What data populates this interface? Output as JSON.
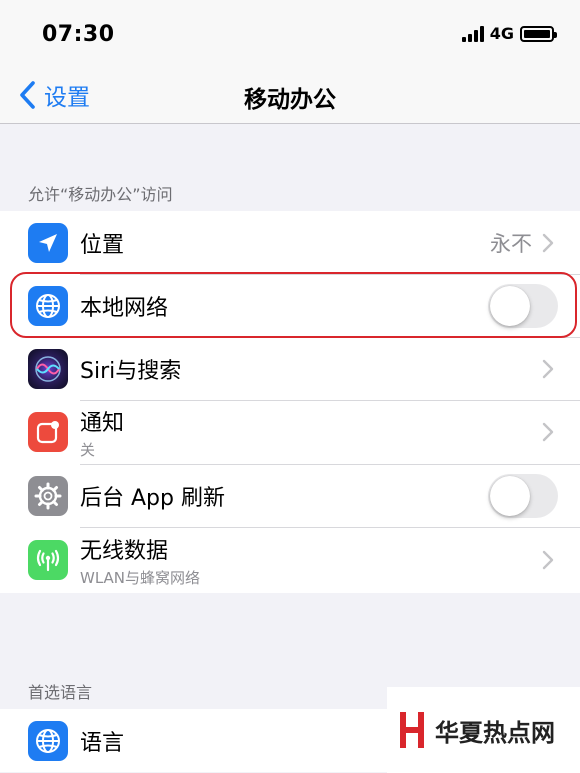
{
  "status_bar": {
    "time": "07:30",
    "network": "4G",
    "icons": [
      "signal-bars-icon",
      "battery-icon"
    ]
  },
  "nav": {
    "back_label": "设置",
    "title": "移动办公"
  },
  "section_allow": {
    "header": "允许“移动办公”访问",
    "rows": [
      {
        "label": "位置",
        "value": "永不",
        "icon": "location-arrow-icon",
        "icon_color": "#1e7cf2"
      },
      {
        "label": "本地网络",
        "icon": "globe-icon",
        "icon_color": "#1e7cf2",
        "toggle_on": false
      },
      {
        "label": "Siri与搜索",
        "icon": "siri-icon",
        "icon_color": "#2b1e5c"
      },
      {
        "label": "通知",
        "sub": "关",
        "icon": "notification-icon",
        "icon_color": "#ed4a3d"
      },
      {
        "label": "后台 App 刷新",
        "icon": "gear-icon",
        "icon_color": "#8e8e93",
        "toggle_on": false
      },
      {
        "label": "无线数据",
        "sub": "WLAN与蜂窝网络",
        "icon": "wireless-antenna-icon",
        "icon_color": "#4cd964"
      }
    ]
  },
  "section_language": {
    "header": "首选语言",
    "rows": [
      {
        "label": "语言",
        "icon": "globe-icon",
        "icon_color": "#1e7cf2"
      }
    ]
  },
  "watermark": {
    "text": "华夏热点网",
    "color": "#d9262c"
  }
}
